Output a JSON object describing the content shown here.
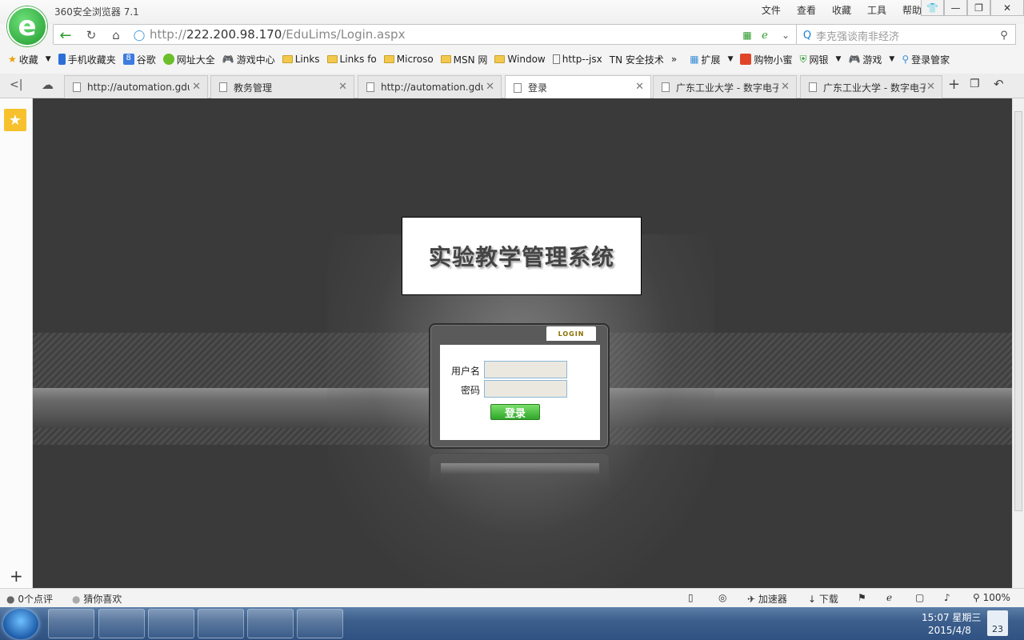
{
  "browser": {
    "title": "360安全浏览器 7.1",
    "menu": [
      "文件",
      "查看",
      "收藏",
      "工具",
      "帮助"
    ],
    "url_prefix": "http://",
    "url_host": "222.200.98.170",
    "url_path": "/EduLims/Login.aspx",
    "search_text": "李克强谈南非经济"
  },
  "bookmarks": [
    {
      "label": "收藏",
      "icon": "star-icon"
    },
    {
      "label": "手机收藏夹",
      "icon": "phone-icon"
    },
    {
      "label": "谷歌",
      "icon": "google-icon"
    },
    {
      "label": "网址大全",
      "icon": "nav-icon"
    },
    {
      "label": "游戏中心",
      "icon": "gamepad-icon"
    },
    {
      "label": "Links",
      "icon": "folder-icon"
    },
    {
      "label": "Links fo",
      "icon": "folder-icon"
    },
    {
      "label": "Microso",
      "icon": "folder-icon"
    },
    {
      "label": "MSN 网",
      "icon": "folder-icon"
    },
    {
      "label": "Window",
      "icon": "folder-icon"
    },
    {
      "label": "http--jsx",
      "icon": "page-icon"
    },
    {
      "label": "TN 安全技术",
      "icon": ""
    }
  ],
  "bookmarks_right": [
    "扩展",
    "购物小蜜",
    "网银",
    "游戏",
    "登录管家"
  ],
  "tabs": [
    {
      "label": "http://automation.gdu"
    },
    {
      "label": "教务管理"
    },
    {
      "label": "http://automation.gdu"
    },
    {
      "label": "登录"
    },
    {
      "label": "广东工业大学 - 数字电子"
    },
    {
      "label": "广东工业大学 - 数字电子"
    }
  ],
  "page": {
    "system_title": "实验教学管理系统",
    "login_tab": "LOGIN",
    "username_label": "用户名",
    "password_label": "密码",
    "login_button": "登录"
  },
  "status": {
    "comments": "0个点评",
    "guess": "猜你喜欢",
    "accelerator": "加速器",
    "download": "下载",
    "zoom": "100%"
  },
  "taskbar": {
    "time": "15:07 星期三",
    "date": "2015/4/8",
    "cal_day": "23"
  }
}
